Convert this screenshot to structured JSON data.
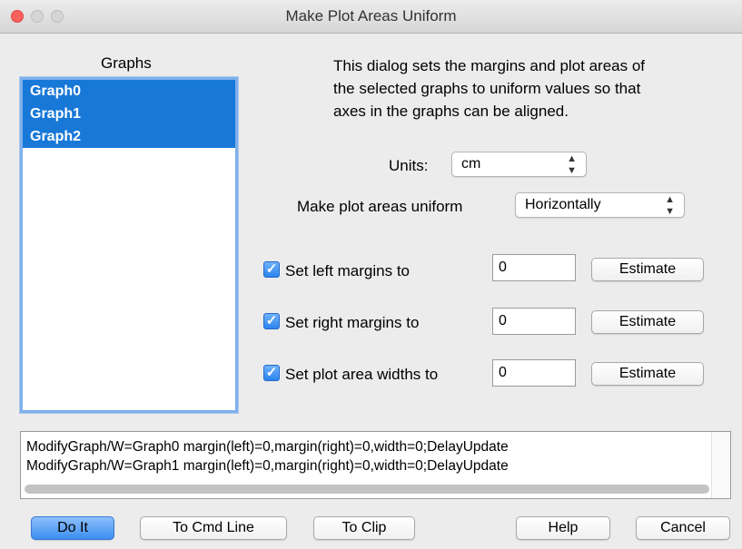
{
  "window": {
    "title": "Make Plot Areas Uniform"
  },
  "graphs": {
    "heading": "Graphs",
    "items": [
      "Graph0",
      "Graph1",
      "Graph2"
    ]
  },
  "description": "This dialog sets the margins and plot areas of the selected graphs to uniform values so that axes in the graphs can be aligned.",
  "units": {
    "label": "Units:",
    "value": "cm"
  },
  "uniform": {
    "label": "Make plot areas uniform",
    "value": "Horizontally"
  },
  "margins": [
    {
      "label": "Set left margins to",
      "checked": true,
      "value": "0",
      "button": "Estimate"
    },
    {
      "label": "Set right margins to",
      "checked": true,
      "value": "0",
      "button": "Estimate"
    },
    {
      "label": "Set plot area widths to",
      "checked": true,
      "value": "0",
      "button": "Estimate"
    }
  ],
  "command_lines": [
    "ModifyGraph/W=Graph0 margin(left)=0,margin(right)=0,width=0;DelayUpdate",
    "ModifyGraph/W=Graph1 margin(left)=0,margin(right)=0,width=0;DelayUpdate"
  ],
  "buttons": {
    "do_it": "Do It",
    "to_cmd_line": "To Cmd Line",
    "to_clip": "To Clip",
    "help": "Help",
    "cancel": "Cancel"
  },
  "icons": {
    "checkmark": "✓",
    "select_arrows": "stepper-arrows-icon"
  },
  "colors": {
    "selection": "#1878d8",
    "accent": "#3c8ef0",
    "close": "#fc605c"
  }
}
